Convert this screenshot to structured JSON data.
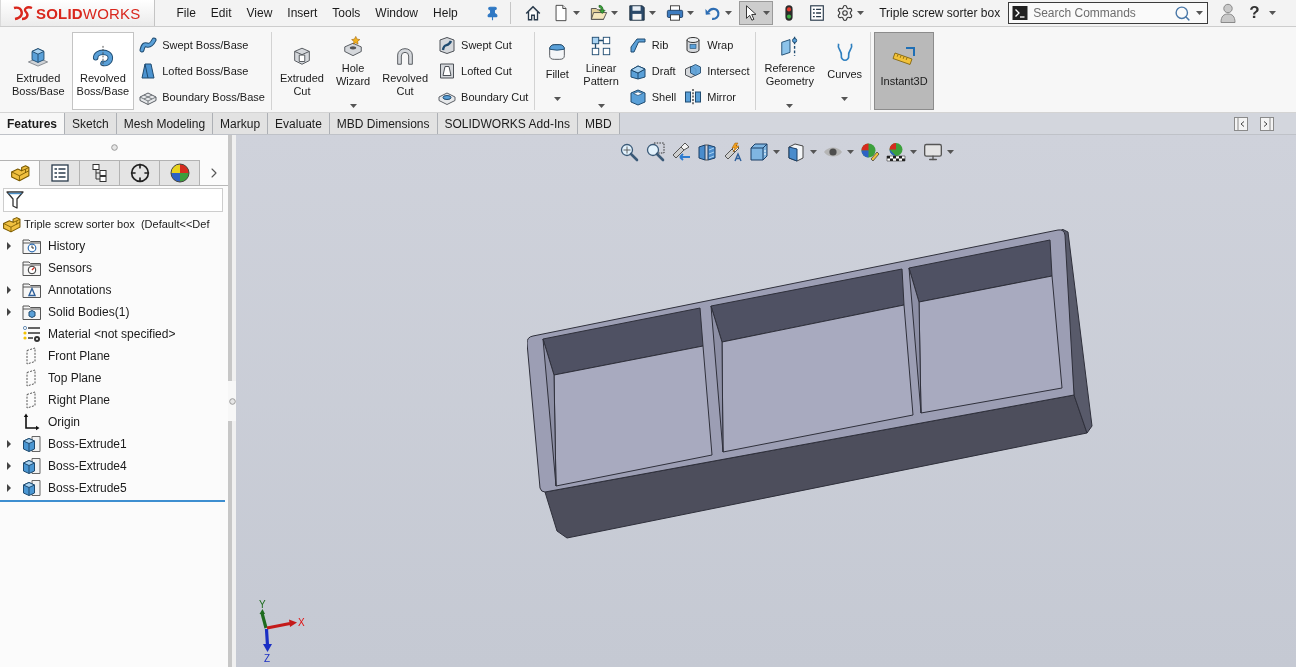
{
  "logo": {
    "wordmark": "**SOLID**WORKS"
  },
  "menu": [
    "File",
    "Edit",
    "View",
    "Insert",
    "Tools",
    "Window",
    "Help"
  ],
  "quick_access": [
    {
      "pressed": false,
      "dropdown": false
    },
    {
      "pressed": false,
      "dropdown": true
    },
    {
      "pressed": false,
      "dropdown": true
    },
    {
      "pressed": false,
      "dropdown": true
    },
    {
      "pressed": false,
      "dropdown": true
    },
    {
      "pressed": false,
      "dropdown": true
    },
    {
      "pressed": true,
      "dropdown": true
    },
    {
      "pressed": false,
      "dropdown": false
    },
    {
      "pressed": false,
      "dropdown": false
    },
    {
      "pressed": false,
      "dropdown": true
    }
  ],
  "document_title": "Triple screw sorter box",
  "search": {
    "placeholder": "Search Commands"
  },
  "help": "?",
  "ribbon": {
    "groups": [
      {
        "items": [
          {
            "kind": "large",
            "label": "Extruded\nBoss/Base",
            "highlighted": false,
            "dropdown": false
          },
          {
            "kind": "large",
            "label": "Revolved\nBoss/Base",
            "highlighted": true,
            "dropdown": false
          },
          {
            "kind": "stack",
            "commands": [
              "Swept Boss/Base",
              "Lofted Boss/Base",
              "Boundary Boss/Base"
            ]
          }
        ]
      },
      {
        "items": [
          {
            "kind": "large",
            "label": "Extruded\nCut",
            "highlighted": false,
            "dropdown": false
          },
          {
            "kind": "large",
            "label": "Hole\nWizard",
            "highlighted": false,
            "dropdown": true
          },
          {
            "kind": "large",
            "label": "Revolved\nCut",
            "highlighted": false,
            "dropdown": false
          },
          {
            "kind": "stack",
            "commands": [
              "Swept Cut",
              "Lofted Cut",
              "Boundary Cut"
            ]
          }
        ]
      },
      {
        "items": [
          {
            "kind": "large",
            "label": "Fillet",
            "highlighted": false,
            "dropdown": true
          },
          {
            "kind": "large",
            "label": "Linear\nPattern",
            "highlighted": false,
            "dropdown": true
          },
          {
            "kind": "stack",
            "commands": [
              "Rib",
              "Draft",
              "Shell"
            ]
          },
          {
            "kind": "stack",
            "commands": [
              "Wrap",
              "Intersect",
              "Mirror"
            ]
          }
        ]
      },
      {
        "items": [
          {
            "kind": "large",
            "label": "Reference\nGeometry",
            "highlighted": false,
            "dropdown": true
          },
          {
            "kind": "large",
            "label": "Curves",
            "highlighted": false,
            "dropdown": true
          }
        ]
      },
      {
        "items": [
          {
            "kind": "toggle",
            "label": "Instant3D",
            "on": true
          }
        ]
      }
    ]
  },
  "command_tabs": [
    {
      "label": "Features",
      "selected": true
    },
    {
      "label": "Sketch",
      "selected": false
    },
    {
      "label": "Mesh Modeling",
      "selected": false
    },
    {
      "label": "Markup",
      "selected": false
    },
    {
      "label": "Evaluate",
      "selected": false
    },
    {
      "label": "MBD Dimensions",
      "selected": false
    },
    {
      "label": "SOLIDWORKS Add-Ins",
      "selected": false
    },
    {
      "label": "MBD",
      "selected": false
    }
  ],
  "feature_manager": {
    "tabs": [
      {
        "selected": true
      },
      {
        "selected": false
      },
      {
        "selected": false
      },
      {
        "selected": false
      },
      {
        "selected": false
      }
    ],
    "root": "Triple screw sorter box  (Default<<Def",
    "items": [
      {
        "label": "History",
        "expanded": false
      },
      {
        "label": "Sensors"
      },
      {
        "label": "Annotations",
        "expanded": false
      },
      {
        "label": "Solid Bodies(1)",
        "expanded": false
      },
      {
        "label": "Material <not specified>"
      },
      {
        "label": "Front Plane"
      },
      {
        "label": "Top Plane"
      },
      {
        "label": "Right Plane"
      },
      {
        "label": "Origin"
      },
      {
        "label": "Boss-Extrude1",
        "expanded": false
      },
      {
        "label": "Boss-Extrude4",
        "expanded": false
      },
      {
        "label": "Boss-Extrude5",
        "expanded": false
      }
    ]
  },
  "view_toolbar": [
    {
      "dropdown": false
    },
    {
      "dropdown": false
    },
    {
      "dropdown": false
    },
    {
      "dropdown": false
    },
    {
      "dropdown": false
    },
    {
      "dropdown": true
    },
    {
      "dropdown": true
    },
    {
      "dropdown": true
    },
    {
      "dropdown": false
    },
    {
      "dropdown": true
    },
    {
      "dropdown": true
    }
  ],
  "triad": {
    "x": "X",
    "y": "Y",
    "z": "Z"
  }
}
